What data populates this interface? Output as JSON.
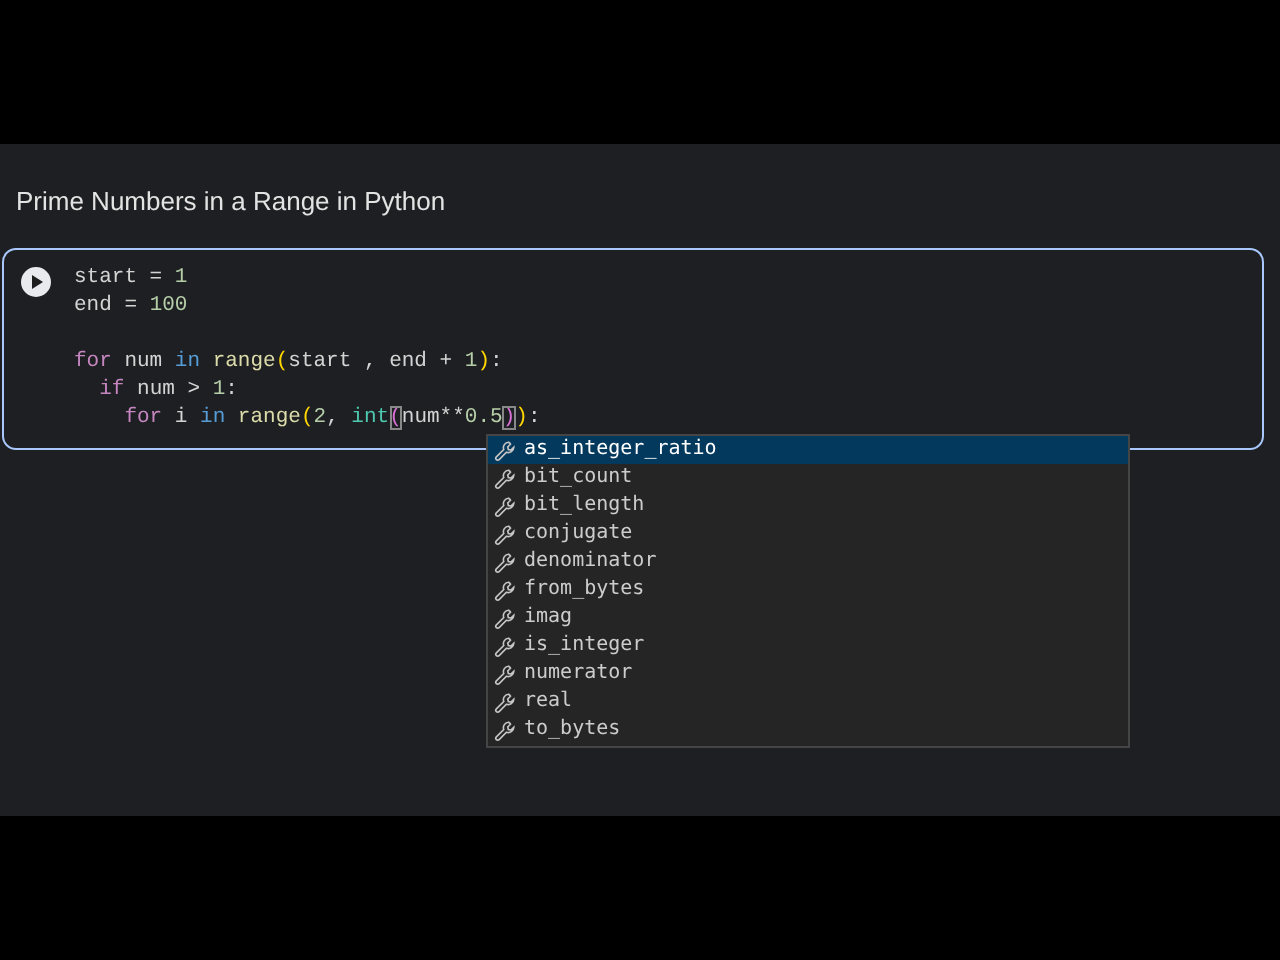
{
  "title": "Prime Numbers in a Range in Python",
  "code_blocks": [
    {
      "lines": [
        {
          "tokens": [
            {
              "kind": "plain",
              "text": "start = "
            },
            {
              "kind": "number",
              "text": "1"
            }
          ]
        },
        {
          "tokens": [
            {
              "kind": "plain",
              "text": "end = "
            },
            {
              "kind": "number",
              "text": "100"
            }
          ]
        }
      ]
    },
    {
      "lines": [
        {
          "tokens": [
            {
              "kind": "keyword",
              "text": "for"
            },
            {
              "kind": "plain",
              "text": " num "
            },
            {
              "kind": "operator",
              "text": "in"
            },
            {
              "kind": "function",
              "text": " range"
            },
            {
              "kind": "paren",
              "text": "("
            },
            {
              "kind": "plain",
              "text": "start , end + "
            },
            {
              "kind": "number",
              "text": "1"
            },
            {
              "kind": "paren",
              "text": ")"
            },
            {
              "kind": "plain",
              "text": ":"
            }
          ]
        },
        {
          "tokens": [
            {
              "kind": "keyword",
              "text": "  if"
            },
            {
              "kind": "plain",
              "text": " num > "
            },
            {
              "kind": "number",
              "text": "1"
            },
            {
              "kind": "plain",
              "text": ":"
            }
          ]
        },
        {
          "tokens": [
            {
              "kind": "keyword",
              "text": "    for"
            },
            {
              "kind": "plain",
              "text": " i "
            },
            {
              "kind": "operator",
              "text": "in"
            },
            {
              "kind": "function",
              "text": " range"
            },
            {
              "kind": "paren",
              "text": "("
            },
            {
              "kind": "number",
              "text": "2"
            },
            {
              "kind": "plain",
              "text": ", "
            },
            {
              "kind": "builtin",
              "text": "int"
            },
            {
              "kind": "matched",
              "text": "("
            },
            {
              "kind": "plain",
              "text": "num**"
            },
            {
              "kind": "number",
              "text": "0.5"
            },
            {
              "kind": "matched",
              "text": ")"
            },
            {
              "kind": "paren",
              "text": ")"
            },
            {
              "kind": "plain",
              "text": ":"
            }
          ]
        }
      ]
    }
  ],
  "suggestions": [
    {
      "label": "as_integer_ratio",
      "selected": true
    },
    {
      "label": "bit_count",
      "selected": false
    },
    {
      "label": "bit_length",
      "selected": false
    },
    {
      "label": "conjugate",
      "selected": false
    },
    {
      "label": "denominator",
      "selected": false
    },
    {
      "label": "from_bytes",
      "selected": false
    },
    {
      "label": "imag",
      "selected": false
    },
    {
      "label": "is_integer",
      "selected": false
    },
    {
      "label": "numerator",
      "selected": false
    },
    {
      "label": "real",
      "selected": false
    },
    {
      "label": "to_bytes",
      "selected": false
    }
  ]
}
